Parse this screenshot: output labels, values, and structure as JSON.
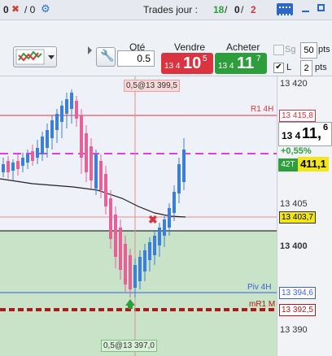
{
  "topbar": {
    "left_a": "0",
    "left_b": "/ 0",
    "trades_label": "Trades jour :",
    "trades_green": "18",
    "trades_sep1": " / ",
    "trades_black": "0",
    "trades_sep2": " / ",
    "trades_red": "2"
  },
  "order": {
    "qty_label": "Qté",
    "qty_value": "0.5",
    "sell_label": "Vendre",
    "sell_prefix": "13 4",
    "sell_big": "10",
    "sell_sup": "5",
    "buy_label": "Acheter",
    "buy_prefix": "13 4",
    "buy_big": "11",
    "buy_sup": "7",
    "sg_label": "Sg",
    "sg_value": "50",
    "l_label": "L",
    "l_value": "2",
    "pts": "pts"
  },
  "chart": {
    "top_tag": "0,5@13 399,5",
    "bottom_tag": "0,5@13 397,0",
    "r1_label": "R1 4H",
    "piv_label": "Piv 4H",
    "mr1_label": "mR1 M",
    "pct": "+0,55%",
    "mode_tag": "42T"
  },
  "axis": {
    "ticks": [
      "13 420",
      "13 405",
      "13 400",
      "13 390"
    ],
    "r1_value": "13 415,8",
    "price_prefix": "13 4",
    "price_big": "11,",
    "price_sup": "6",
    "last_value": "411,1",
    "entry_value": "13 403,7",
    "piv_value": "13 394,6",
    "mr1_value": "13 392,5"
  },
  "colors": {
    "sell": "#d9343f",
    "buy": "#2e9e3c",
    "up_candle": "#3c7fd6",
    "down_candle": "#e8609a",
    "magenta": "#e03ee0"
  }
}
